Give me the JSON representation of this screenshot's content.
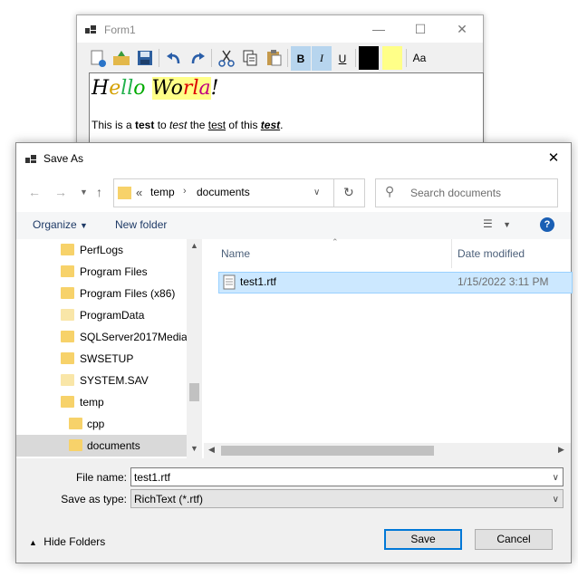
{
  "form": {
    "title": "Form1",
    "format_labels": {
      "bold": "B",
      "italic": "I",
      "underline": "U",
      "font": "Aa"
    },
    "colors": {
      "fore": "#000000",
      "back": "#ffff88"
    },
    "hello": {
      "h": "H",
      "e": "e",
      "ll": "ll",
      "o": "o",
      "space": " ",
      "Wo": "Wo",
      "r": "r",
      "l": "l",
      "a": "a",
      "bang": "!"
    },
    "sample": {
      "p1": "This is a ",
      "test1": "test",
      "p2": " to ",
      "test2": "test",
      "p3": " the ",
      "test3": "test",
      "p4": " of this ",
      "test4": "test",
      "p5": "."
    }
  },
  "dialog": {
    "title": "Save As",
    "address": {
      "overflow": "«",
      "crumbs": [
        "temp",
        "documents"
      ]
    },
    "search_placeholder": "Search documents",
    "organize_label": "Organize",
    "new_folder_label": "New folder",
    "nav_items": [
      {
        "label": "PerfLogs"
      },
      {
        "label": "Program Files"
      },
      {
        "label": "Program Files (x86)"
      },
      {
        "label": "ProgramData"
      },
      {
        "label": "SQLServer2017Media"
      },
      {
        "label": "SWSETUP"
      },
      {
        "label": "SYSTEM.SAV"
      },
      {
        "label": "temp"
      },
      {
        "label": "cpp"
      },
      {
        "label": "documents"
      }
    ],
    "columns": {
      "name": "Name",
      "date_modified": "Date modified"
    },
    "files": [
      {
        "name": "test1.rtf",
        "date_modified": "1/15/2022 3:11 PM"
      }
    ],
    "file_name_label": "File name:",
    "file_name_value": "test1.rtf",
    "save_type_label": "Save as type:",
    "save_type_value": "RichText (*.rtf)",
    "hide_folders_label": "Hide Folders",
    "save_label": "Save",
    "cancel_label": "Cancel"
  }
}
